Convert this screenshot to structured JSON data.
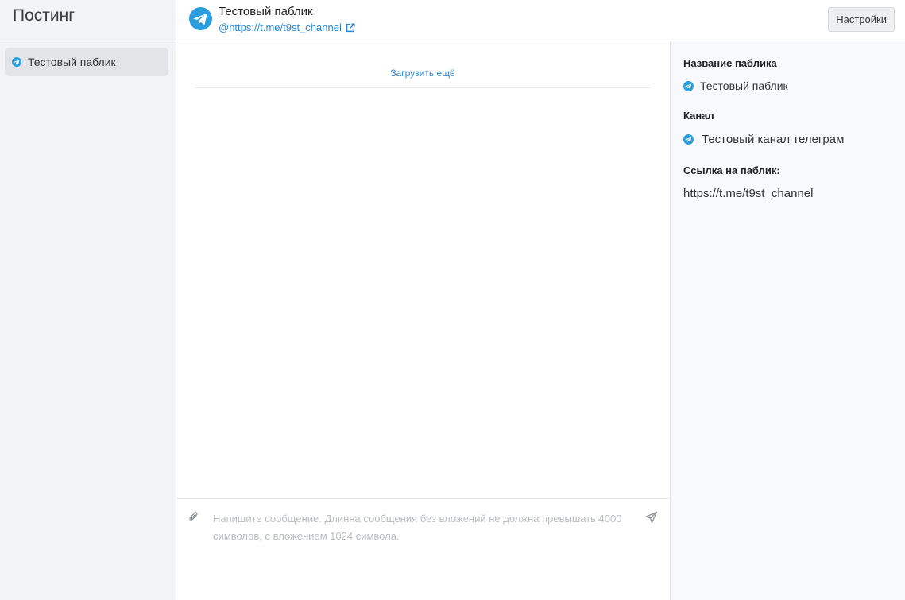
{
  "sidebar": {
    "title": "Постинг",
    "items": [
      {
        "label": "Тестовый паблик",
        "icon": "telegram-icon"
      }
    ]
  },
  "header": {
    "title": "Тестовый паблик",
    "link": "@https://t.me/t9st_channel",
    "settings_label": "Настройки"
  },
  "chat": {
    "load_more": "Загрузить ещё",
    "input_placeholder": "Напишите сообщение. Длинна сообщения без вложений не должна превышать 4000 символов, с вложением 1024 символа.",
    "input_value": ""
  },
  "info": {
    "name_heading": "Название паблика",
    "name_value": "Тестовый паблик",
    "channel_heading": "Канал",
    "channel_value": "Тестовый канал телеграм",
    "link_heading": "Ссылка на паблик:",
    "link_value": "https://t.me/t9st_channel"
  },
  "colors": {
    "accent": "#2c86d0",
    "telegram": "#2c9ee0",
    "sidebar_bg": "#f2f3f5",
    "info_bg": "#f7f9fc"
  }
}
